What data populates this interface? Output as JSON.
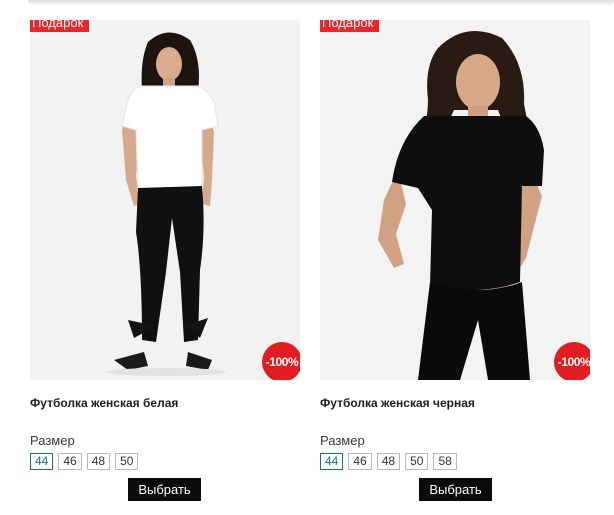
{
  "products": [
    {
      "badge": "Подарок",
      "discount": "-100%",
      "title": "Футболка женская белая",
      "size_label": "Размер",
      "sizes": [
        "44",
        "46",
        "48",
        "50"
      ],
      "selected_size": "44",
      "button_label": "Выбрать"
    },
    {
      "badge": "Подарок",
      "discount": "-100%",
      "title": "Футболка женская черная",
      "size_label": "Размер",
      "sizes": [
        "44",
        "46",
        "48",
        "50",
        "58"
      ],
      "selected_size": "44",
      "button_label": "Выбрать"
    }
  ],
  "colors": {
    "badge_red": "#e8262b",
    "discount_red": "#e21d22",
    "selected_size_border": "#1b6d93",
    "button_bg": "#0b0b0b"
  }
}
